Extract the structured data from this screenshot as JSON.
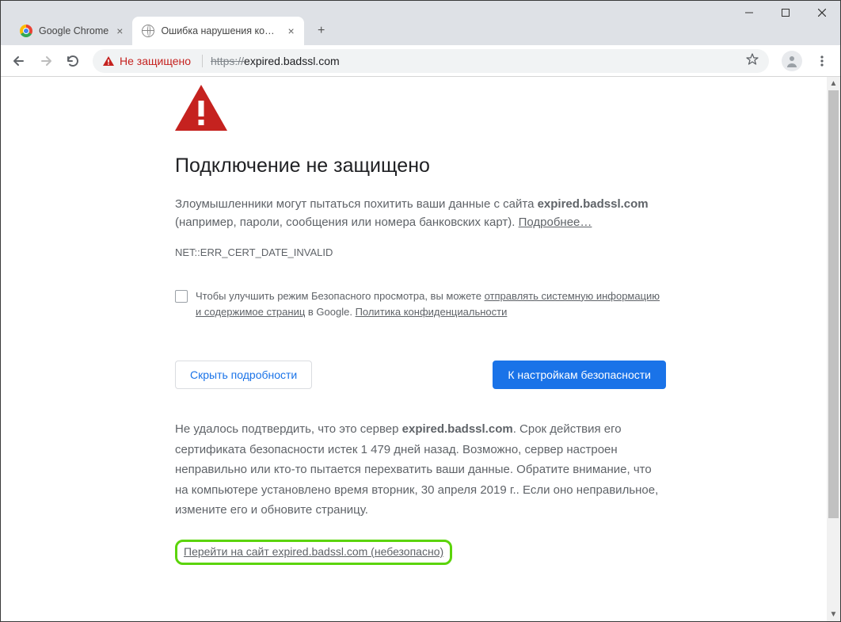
{
  "window": {
    "tabs": [
      {
        "title": "Google Chrome",
        "active": false
      },
      {
        "title": "Ошибка нарушения конфиденц",
        "active": true
      }
    ]
  },
  "toolbar": {
    "security_label": "Не защищено",
    "url_scheme": "https://",
    "url_rest": "expired.badssl.com"
  },
  "page": {
    "heading": "Подключение не защищено",
    "para1_pre": "Злоумышленники могут пытаться похитить ваши данные с сайта ",
    "para1_domain": "expired.badssl.com",
    "para1_post": " (например, пароли, сообщения или номера банковских карт). ",
    "learn_more": "Подробнее…",
    "error_code": "NET::ERR_CERT_DATE_INVALID",
    "optin_pre": "Чтобы улучшить режим Безопасного просмотра, вы можете ",
    "optin_link1": "отправлять системную информацию и содержимое страниц",
    "optin_mid": " в Google. ",
    "optin_link2": "Политика конфиденциальности",
    "hide_details": "Скрыть подробности",
    "back_safety": "К настройкам безопасности",
    "details_pre": "Не удалось подтвердить, что это сервер ",
    "details_domain": "expired.badssl.com",
    "details_post": ". Срок действия его сертификата безопасности истек 1 479 дней назад. Возможно, сервер настроен неправильно или кто-то пытается перехватить ваши данные. Обратите внимание, что на компьютере установлено время вторник, 30 апреля 2019 г.. Если оно неправильное, измените его и обновите страницу.",
    "proceed": "Перейти на сайт expired.badssl.com (небезопасно)"
  }
}
